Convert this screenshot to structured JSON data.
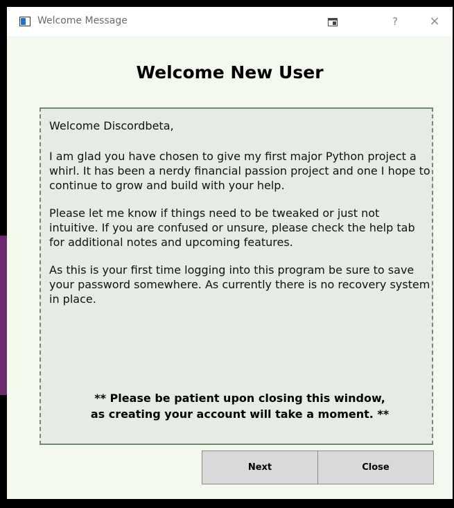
{
  "window": {
    "title": "Welcome  Message",
    "title_bar_buttons": {
      "pin_icon": "window-pin-icon",
      "help_label": "?",
      "close_label": "×"
    }
  },
  "heading": "Welcome New User",
  "message": {
    "greeting": "Welcome Discordbeta,",
    "paragraph_1": "I am glad you have chosen to give my first major Python project a whirl. It has been a nerdy financial passion project and one I hope to continue to grow and build with your help.",
    "paragraph_2": "Please let me know if things need to be tweaked or just not intuitive. If you are confused or unsure, please check the help tab for additional notes and upcoming features.",
    "paragraph_3": "As this is your first time logging into this program be sure to save your password somewhere. As currently there is no recovery system in place.",
    "notice_line_1": "** Please be patient upon closing this window,",
    "notice_line_2": "as creating your account will take a moment. **"
  },
  "buttons": {
    "next_label": "Next",
    "close_label": "Close"
  },
  "colors": {
    "window_background": "#f3f9ee",
    "message_background": "#e6ebe3",
    "message_border": "#6f8a6c",
    "button_background": "#d9d9d9"
  }
}
